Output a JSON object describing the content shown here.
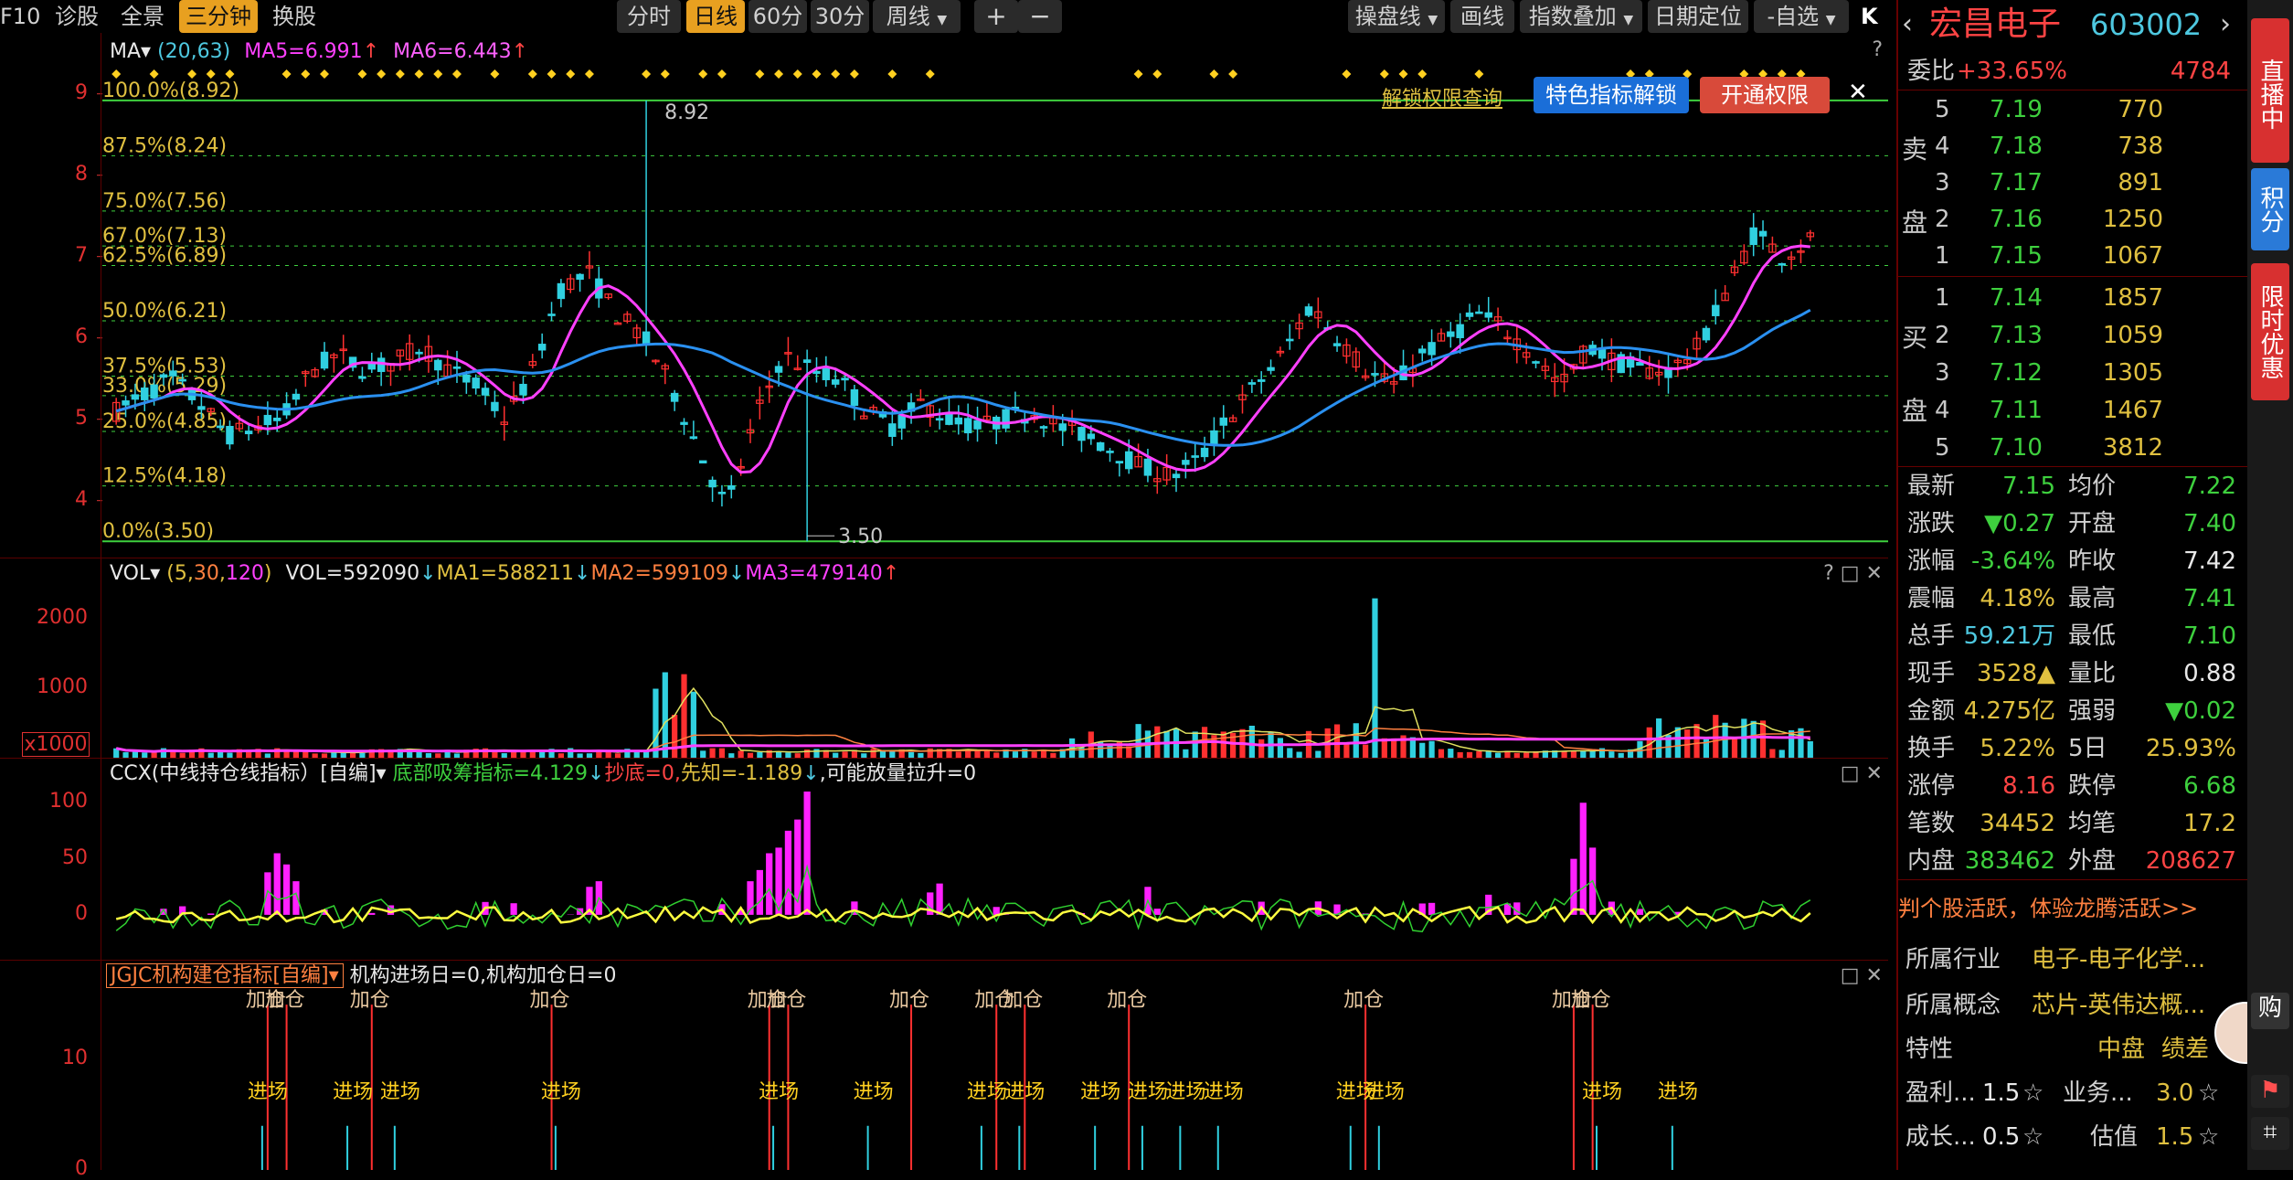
{
  "toolbar": {
    "f10": "F10",
    "zhengu": "诊股",
    "quanjing": "全景",
    "sanfenzhong": "三分钟",
    "huangu": "换股",
    "fenshi": "分时",
    "rixian": "日线",
    "min60": "60分",
    "min30": "30分",
    "zhouxian": "周线",
    "plus": "+",
    "minus": "−",
    "caopanxian": "操盘线",
    "huaxian": "画线",
    "zhishu": "指数叠加",
    "riqi": "日期定位",
    "zixuan": "-自选",
    "jump": "K"
  },
  "main_chart": {
    "legend_ma": "MA",
    "legend_params": "(20,63)",
    "ma5": "MA5=6.991",
    "ma6": "MA6=6.443",
    "top_left_label": "100.0%(8.92)",
    "high_label": "8.92",
    "low_label": "3.50",
    "y_ticks": [
      "9",
      "8",
      "7",
      "6",
      "5",
      "4"
    ],
    "fib_levels": [
      {
        "label": "87.5%(8.24)",
        "price": 8.24
      },
      {
        "label": "75.0%(7.56)",
        "price": 7.56
      },
      {
        "label": "67.0%(7.13)",
        "price": 7.13
      },
      {
        "label": "62.5%(6.89)",
        "price": 6.89
      },
      {
        "label": "50.0%(6.21)",
        "price": 6.21
      },
      {
        "label": "37.5%(5.53)",
        "price": 5.53
      },
      {
        "label": "33.0%(5.29)",
        "price": 5.29
      },
      {
        "label": "25.0%(4.85)",
        "price": 4.85
      },
      {
        "label": "12.5%(4.18)",
        "price": 4.18
      },
      {
        "label": "0.0%(3.50)",
        "price": 3.5
      }
    ],
    "unlock_link": "解锁权限查询",
    "btn_feature": "特色指标解锁",
    "btn_open": "开通权限",
    "close": "✕",
    "help": "?"
  },
  "vol_chart": {
    "legend": "VOL",
    "params_5": "5",
    "params_30": "30",
    "params_120": "120",
    "vol": "VOL=592090",
    "ma1": "MA1=588211",
    "ma2": "MA2=599109",
    "ma3": "MA3=479140",
    "y_ticks": [
      "2000",
      "1000"
    ],
    "unit": "x1000"
  },
  "ccx_chart": {
    "legend": "CCX(中线持仓线指标）[自编]",
    "v1": "底部吸筹指标=4.129",
    "v2": "抄底=0",
    "v3": "先知=-1.189",
    "v4": "可能放量拉升=0",
    "y_ticks": [
      "100",
      "50",
      "0"
    ]
  },
  "jgjc_chart": {
    "legend": "JGJC机构建仓指标[自编]",
    "v1": "机构进场日=0",
    "v2": "机构加仓日=0",
    "y_ticks": [
      "10",
      "0"
    ],
    "add_label": "加仓",
    "enter_label": "进场"
  },
  "stock": {
    "name": "宏昌电子",
    "code": "603002",
    "weibi_label": "委比",
    "weibi": "+33.65%",
    "weicha": "4784",
    "sell_side": "卖",
    "sell_side2": "盘",
    "buy_side": "买",
    "buy_side2": "盘",
    "asks": [
      {
        "lvl": "5",
        "price": "7.19",
        "vol": "770"
      },
      {
        "lvl": "4",
        "price": "7.18",
        "vol": "738"
      },
      {
        "lvl": "3",
        "price": "7.17",
        "vol": "891"
      },
      {
        "lvl": "2",
        "price": "7.16",
        "vol": "1250"
      },
      {
        "lvl": "1",
        "price": "7.15",
        "vol": "1067"
      }
    ],
    "bids": [
      {
        "lvl": "1",
        "price": "7.14",
        "vol": "1857"
      },
      {
        "lvl": "2",
        "price": "7.13",
        "vol": "1059"
      },
      {
        "lvl": "3",
        "price": "7.12",
        "vol": "1305"
      },
      {
        "lvl": "4",
        "price": "7.11",
        "vol": "1467"
      },
      {
        "lvl": "5",
        "price": "7.10",
        "vol": "3812"
      }
    ],
    "quotes": [
      {
        "l1": "最新",
        "v1": "7.15",
        "c1": "g",
        "l2": "均价",
        "v2": "7.22",
        "c2": "g"
      },
      {
        "l1": "涨跌",
        "v1": "▼0.27",
        "c1": "g",
        "l2": "开盘",
        "v2": "7.40",
        "c2": "g"
      },
      {
        "l1": "涨幅",
        "v1": "-3.64%",
        "c1": "g",
        "l2": "昨收",
        "v2": "7.42",
        "c2": "w"
      },
      {
        "l1": "震幅",
        "v1": "4.18%",
        "c1": "y",
        "l2": "最高",
        "v2": "7.41",
        "c2": "g"
      },
      {
        "l1": "总手",
        "v1": "59.21万",
        "c1": "c",
        "l2": "最低",
        "v2": "7.10",
        "c2": "g"
      },
      {
        "l1": "现手",
        "v1": "3528▲",
        "c1": "y",
        "l2": "量比",
        "v2": "0.88",
        "c2": "w"
      },
      {
        "l1": "金额",
        "v1": "4.275亿",
        "c1": "y",
        "l2": "强弱",
        "v2": "▼0.02",
        "c2": "g"
      },
      {
        "l1": "换手",
        "v1": "5.22%",
        "c1": "y",
        "l2": "5日",
        "v2": "25.93%",
        "c2": "y"
      },
      {
        "l1": "涨停",
        "v1": "8.16",
        "c1": "r",
        "l2": "跌停",
        "v2": "6.68",
        "c2": "g"
      },
      {
        "l1": "笔数",
        "v1": "34452",
        "c1": "y",
        "l2": "均笔",
        "v2": "17.2",
        "c2": "y"
      },
      {
        "l1": "内盘",
        "v1": "383462",
        "c1": "g",
        "l2": "外盘",
        "v2": "208627",
        "c2": "r"
      }
    ],
    "promo": "判个股活跃，体验龙腾活跃>>",
    "industry_label": "所属行业",
    "industry": "电子-电子化学...",
    "concept_label": "所属概念",
    "concept": "芯片-英伟达概...",
    "feature_label": "特性",
    "feature1": "中盘",
    "feature2": "绩差",
    "rating_row1_a": "盈利...",
    "rating_row1_a_val": "1.5",
    "rating_row1_b": "业务...",
    "rating_row1_b_val": "3.0",
    "rating_row2_a": "成长...",
    "rating_row2_a_val": "0.5",
    "rating_row2_b": "估值",
    "rating_row2_b_val": "1.5"
  },
  "strip": {
    "live": "直播中",
    "points": "积分",
    "limited": "限时优惠",
    "buy": "购"
  }
}
